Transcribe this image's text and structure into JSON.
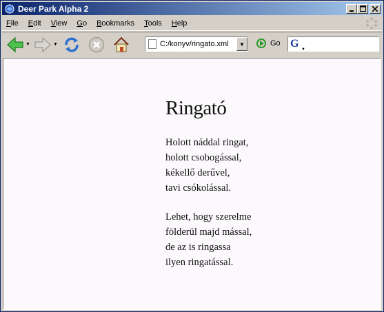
{
  "window": {
    "title": "Deer Park Alpha 2"
  },
  "menu": [
    {
      "label": "File",
      "accel": "F",
      "rest": "ile"
    },
    {
      "label": "Edit",
      "accel": "E",
      "rest": "dit"
    },
    {
      "label": "View",
      "accel": "V",
      "rest": "iew"
    },
    {
      "label": "Go",
      "accel": "G",
      "rest": "o"
    },
    {
      "label": "Bookmarks",
      "accel": "B",
      "rest": "ookmarks"
    },
    {
      "label": "Tools",
      "accel": "T",
      "rest": "ools"
    },
    {
      "label": "Help",
      "accel": "H",
      "rest": "elp"
    }
  ],
  "toolbar": {
    "url": "C:/konyv/ringato.xml",
    "go_label": "Go",
    "search_engine": "G"
  },
  "colors": {
    "title_start": "#0a246a",
    "title_end": "#a6caf0",
    "back_arrow": "#2f9e2f",
    "reload": "#2d6fcf"
  },
  "poem": {
    "title": "Ringató",
    "stanzas": [
      [
        "Holott náddal ringat,",
        "holott csobogással,",
        "kékellő derűvel,",
        "tavi csókolással."
      ],
      [
        "Lehet, hogy szerelme",
        "földerül majd mással,",
        "de az is ringassa",
        "ilyen ringatással."
      ]
    ]
  }
}
